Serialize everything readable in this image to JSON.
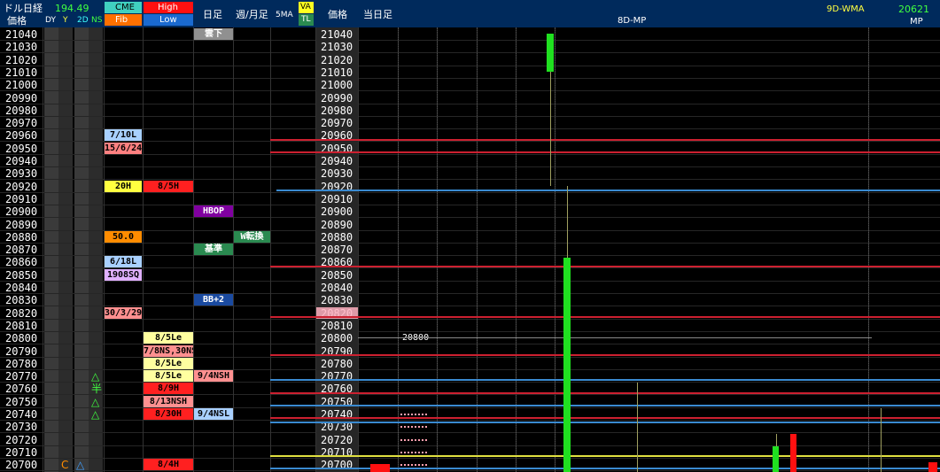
{
  "header": {
    "title": "ドル日経",
    "rate": "194.49",
    "price_label": "価格",
    "cols": [
      "DY",
      "Y",
      "2D",
      "NS"
    ],
    "cme": "CME",
    "fib": "Fib",
    "high": "High",
    "low": "Low",
    "daily": "日足",
    "weekly_monthly": "週/月足",
    "ma5": "5MA",
    "va": "VA",
    "tl": "TL",
    "price_label2": "価格",
    "today": "当日足",
    "mp8d": "8D-MP",
    "wma9d": "9D-WMA",
    "mp_value": "20621",
    "mp": "MP"
  },
  "prices": [
    "21040",
    "21030",
    "21020",
    "21010",
    "21000",
    "20990",
    "20980",
    "20970",
    "20960",
    "20950",
    "20940",
    "20930",
    "20920",
    "20910",
    "20900",
    "20890",
    "20880",
    "20870",
    "20860",
    "20850",
    "20840",
    "20830",
    "20820",
    "20810",
    "20800",
    "20790",
    "20780",
    "20770",
    "20760",
    "20750",
    "20740",
    "20730",
    "20720",
    "20710",
    "20700"
  ],
  "cme_boxes": [
    {
      "row": 8,
      "text": "7/10L",
      "bg": "#a8d0ff",
      "fg": "#000"
    },
    {
      "row": 9,
      "text": "15/6/24H",
      "bg": "#ff8080",
      "fg": "#000"
    },
    {
      "row": 12,
      "text": "20H",
      "bg": "#ffff40",
      "fg": "#000"
    },
    {
      "row": 16,
      "text": "50.0",
      "bg": "#ff8c00",
      "fg": "#000"
    },
    {
      "row": 18,
      "text": "6/18L",
      "bg": "#a8d0ff",
      "fg": "#000"
    },
    {
      "row": 19,
      "text": "1908SQ",
      "bg": "#e0b0ff",
      "fg": "#000"
    },
    {
      "row": 22,
      "text": "30/3/29H",
      "bg": "#ff9090",
      "fg": "#000"
    }
  ],
  "highlow_boxes": [
    {
      "row": 12,
      "text": "8/5H",
      "bg": "#ff2020",
      "fg": "#000"
    },
    {
      "row": 24,
      "text": "8/5Le",
      "bg": "#ffffa0",
      "fg": "#000"
    },
    {
      "row": 25,
      "text": "7/8NS,30NSH",
      "bg": "#ff9090",
      "fg": "#000"
    },
    {
      "row": 26,
      "text": "8/5Le",
      "bg": "#ffffa0",
      "fg": "#000"
    },
    {
      "row": 27,
      "text": "8/5Le",
      "bg": "#ffffa0",
      "fg": "#000"
    },
    {
      "row": 28,
      "text": "8/9H",
      "bg": "#ff2020",
      "fg": "#000"
    },
    {
      "row": 29,
      "text": "8/13NSH",
      "bg": "#ff9090",
      "fg": "#000"
    },
    {
      "row": 30,
      "text": "8/30H",
      "bg": "#ff2020",
      "fg": "#000"
    },
    {
      "row": 34,
      "text": "8/4H",
      "bg": "#ff2020",
      "fg": "#000"
    }
  ],
  "daily_boxes": [
    {
      "row": 0,
      "text": "雲下",
      "bg": "#909090",
      "fg": "#fff"
    },
    {
      "row": 14,
      "text": "HBOP",
      "bg": "#8000a0",
      "fg": "#fff"
    },
    {
      "row": 17,
      "text": "基準",
      "bg": "#2a8a50",
      "fg": "#fff"
    },
    {
      "row": 21,
      "text": "BB+2",
      "bg": "#1a4aa0",
      "fg": "#fff"
    },
    {
      "row": 27,
      "text": "9/4NSH",
      "bg": "#ff9090",
      "fg": "#000"
    },
    {
      "row": 30,
      "text": "9/4NSL",
      "bg": "#a8d0ff",
      "fg": "#000"
    }
  ],
  "weekly_boxes": [
    {
      "row": 16,
      "text": "W転換",
      "bg": "#2a8a50",
      "fg": "#fff"
    }
  ],
  "markers": [
    {
      "row": 27,
      "text": "△",
      "color": "#40ff40"
    },
    {
      "row": 28,
      "text": "半",
      "color": "#40ff40"
    },
    {
      "row": 29,
      "text": "△",
      "color": "#40ff40"
    },
    {
      "row": 30,
      "text": "△",
      "color": "#40ff40"
    }
  ],
  "bottom_markers": [
    {
      "text": "C",
      "color": "#ff8c00"
    },
    {
      "text": "△",
      "color": "#40a0ff"
    }
  ],
  "cursor_label": "20800",
  "colors": {
    "red": "#cc2030",
    "blue": "#3a8ad0",
    "yellow": "#e0e040",
    "green": "#20e020"
  }
}
